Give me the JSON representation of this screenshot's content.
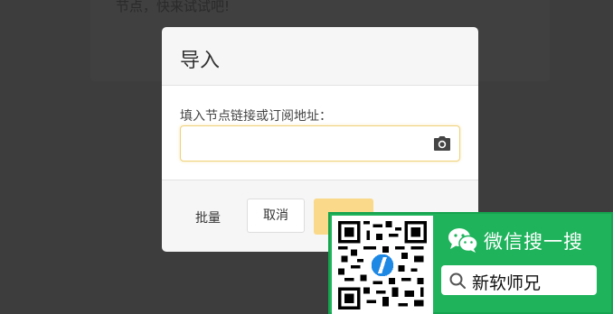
{
  "background": {
    "text": "节点，快来试试吧!"
  },
  "modal": {
    "title": "导入",
    "field_label": "填入节点链接或订阅地址：",
    "input": {
      "value": "",
      "placeholder": ""
    },
    "camera_icon": "camera-icon",
    "buttons": {
      "batch": "批量",
      "cancel": "取消",
      "confirm": ""
    }
  },
  "promo": {
    "title": "微信搜一搜",
    "search_text": "新软师兄",
    "icons": [
      "qr-code-icon",
      "wechat-icon",
      "search-icon"
    ]
  },
  "colors": {
    "overlay": "#3d3d3d",
    "modal_bg": "#f6f6f6",
    "input_border": "#f0d27a",
    "confirm_button": "#fbd98a",
    "promo_green": "#1fb45c"
  }
}
